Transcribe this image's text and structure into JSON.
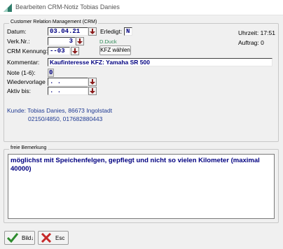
{
  "window": {
    "title": "Bearbeiten CRM-Notiz Tobias Danies"
  },
  "crm": {
    "legend": "Customer Relation Management (CRM)",
    "datum_label": "Datum:",
    "datum_value": "03.04.21",
    "erledigt_label": "Erledigt:",
    "erledigt_value": "N",
    "uhrzeit": "Uhrzeit: 17:51",
    "verk_label": "Verk.Nr.:",
    "verk_value": "3",
    "verk_name": "D.Duck",
    "auftrag": "Auftrag: 0",
    "kennung_label": "CRM Kennung:",
    "kennung_value": "--03",
    "kfz_button": "KFZ wählen",
    "kommentar_label": "Kommentar:",
    "kommentar_value": "Kaufinteresse KFZ: Yamaha SR 500",
    "note_label": "Note (1-6):",
    "note_value": "0",
    "wiedervorlage_label": "Wiedervorlage",
    "wiedervorlage_value": " .  . ",
    "aktiv_label": "Aktiv bis:",
    "aktiv_value": " .  . ",
    "kunde_line1": "Kunde: Tobias Danies, 86673 Ingolstadt",
    "kunde_line2": "02150/4850, 017682880443"
  },
  "bemerkung": {
    "legend": "freie Bemerkung",
    "text": "möglichst mit Speichenfelgen, gepflegt und nicht so vielen Kilometer (maximal 40000)"
  },
  "buttons": {
    "bild": "Bild",
    "esc": "Esc"
  },
  "icons": {
    "app": "app-logo-icon",
    "spin": "spin-down-icon",
    "bild": "checkmark-icon",
    "esc": "cross-icon"
  },
  "colors": {
    "value_text": "#000080",
    "kunde_text": "#1f3a93",
    "verk_name": "#2e8b57",
    "spin_arrow": "#8b1a1a"
  }
}
